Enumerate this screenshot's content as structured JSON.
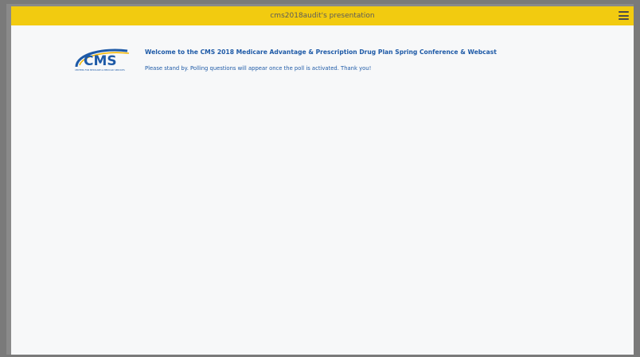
{
  "header": {
    "title": "cms2018audit's presentation",
    "menu_icon": "hamburger-menu-icon",
    "background_color": "#f2cb10"
  },
  "logo": {
    "text": "CMS",
    "tagline": "CENTERS FOR MEDICARE & MEDICAID SERVICES",
    "icon": "cms-logo"
  },
  "main": {
    "heading": "Welcome to the CMS 2018 Medicare Advantage & Prescription Drug Plan Spring Conference & Webcast",
    "message": "Please stand by. Polling questions will appear once the poll is activated. Thank you!"
  },
  "colors": {
    "accent": "#1e5aa7",
    "content_background": "#f7f8f9",
    "frame": "#8a8a8a"
  }
}
